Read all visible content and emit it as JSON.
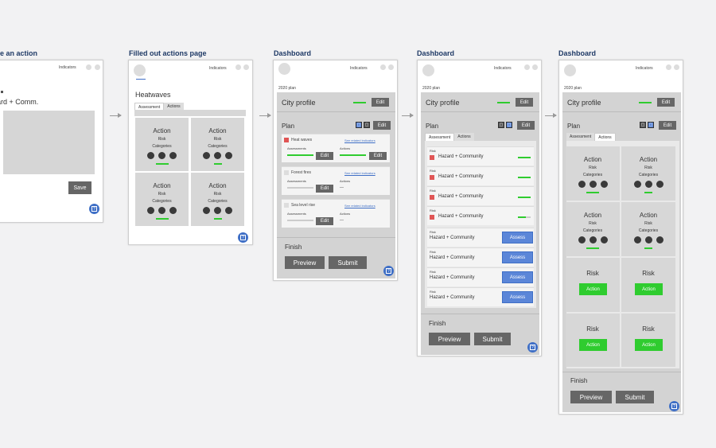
{
  "frames": {
    "f1": {
      "title": "e an action",
      "indicators": "Indicators",
      "text_line": "ard + Comm.",
      "save": "Save"
    },
    "f2": {
      "title": "Filled out actions page",
      "indicators": "Indicators",
      "heading": "Heatwaves",
      "tabs": [
        "Assessment",
        "Actions"
      ],
      "cards": [
        {
          "title": "Action",
          "risk": "Risk",
          "categories": "Categories"
        },
        {
          "title": "Action",
          "risk": "Risk",
          "categories": "Categories"
        },
        {
          "title": "Action",
          "risk": "Risk",
          "categories": "Categories"
        },
        {
          "title": "Action",
          "risk": "Risk",
          "categories": "Categories"
        }
      ]
    },
    "f3": {
      "title": "Dashboard",
      "indicators": "Indicators",
      "plan_year": "2020 plan",
      "city_profile": "City profile",
      "edit": "Edit",
      "plan": "Plan",
      "items": [
        {
          "name": "Heat waves",
          "link": "See related indicators",
          "assessments": "Assessments",
          "actions": "Actions",
          "actions_value": "",
          "edit": "Edit"
        },
        {
          "name": "Forest fires",
          "link": "See related indicators",
          "assessments": "Assessments",
          "actions": "Actions",
          "actions_value": "—",
          "edit": "Edit"
        },
        {
          "name": "Sea level rise",
          "link": "See related indicators",
          "assessments": "Assessments",
          "actions": "Actions",
          "actions_value": "—",
          "edit": "Edit"
        }
      ],
      "finish": "Finish",
      "preview": "Preview",
      "submit": "Submit"
    },
    "f4": {
      "title": "Dashboard",
      "indicators": "Indicators",
      "plan_year": "2020 plan",
      "city_profile": "City profile",
      "edit": "Edit",
      "plan": "Plan",
      "tabs": [
        "Assessment",
        "Actions"
      ],
      "risk_label": "Risk",
      "hazard": "Hazard + Community",
      "assess": "Assess",
      "finish": "Finish",
      "preview": "Preview",
      "submit": "Submit"
    },
    "f5": {
      "title": "Dashboard",
      "indicators": "Indicators",
      "plan_year": "2020 plan",
      "city_profile": "City profile",
      "edit": "Edit",
      "plan": "Plan",
      "tabs": [
        "Assessment",
        "Actions"
      ],
      "action": "Action",
      "risk": "Risk",
      "categories": "Categories",
      "action_btn": "Action",
      "finish": "Finish",
      "preview": "Preview",
      "submit": "Submit"
    }
  },
  "colors": {
    "accent_blue": "#3f6fc6",
    "green": "#2fcc2f",
    "red": "#e05555",
    "title_blue": "#1f3a66"
  }
}
